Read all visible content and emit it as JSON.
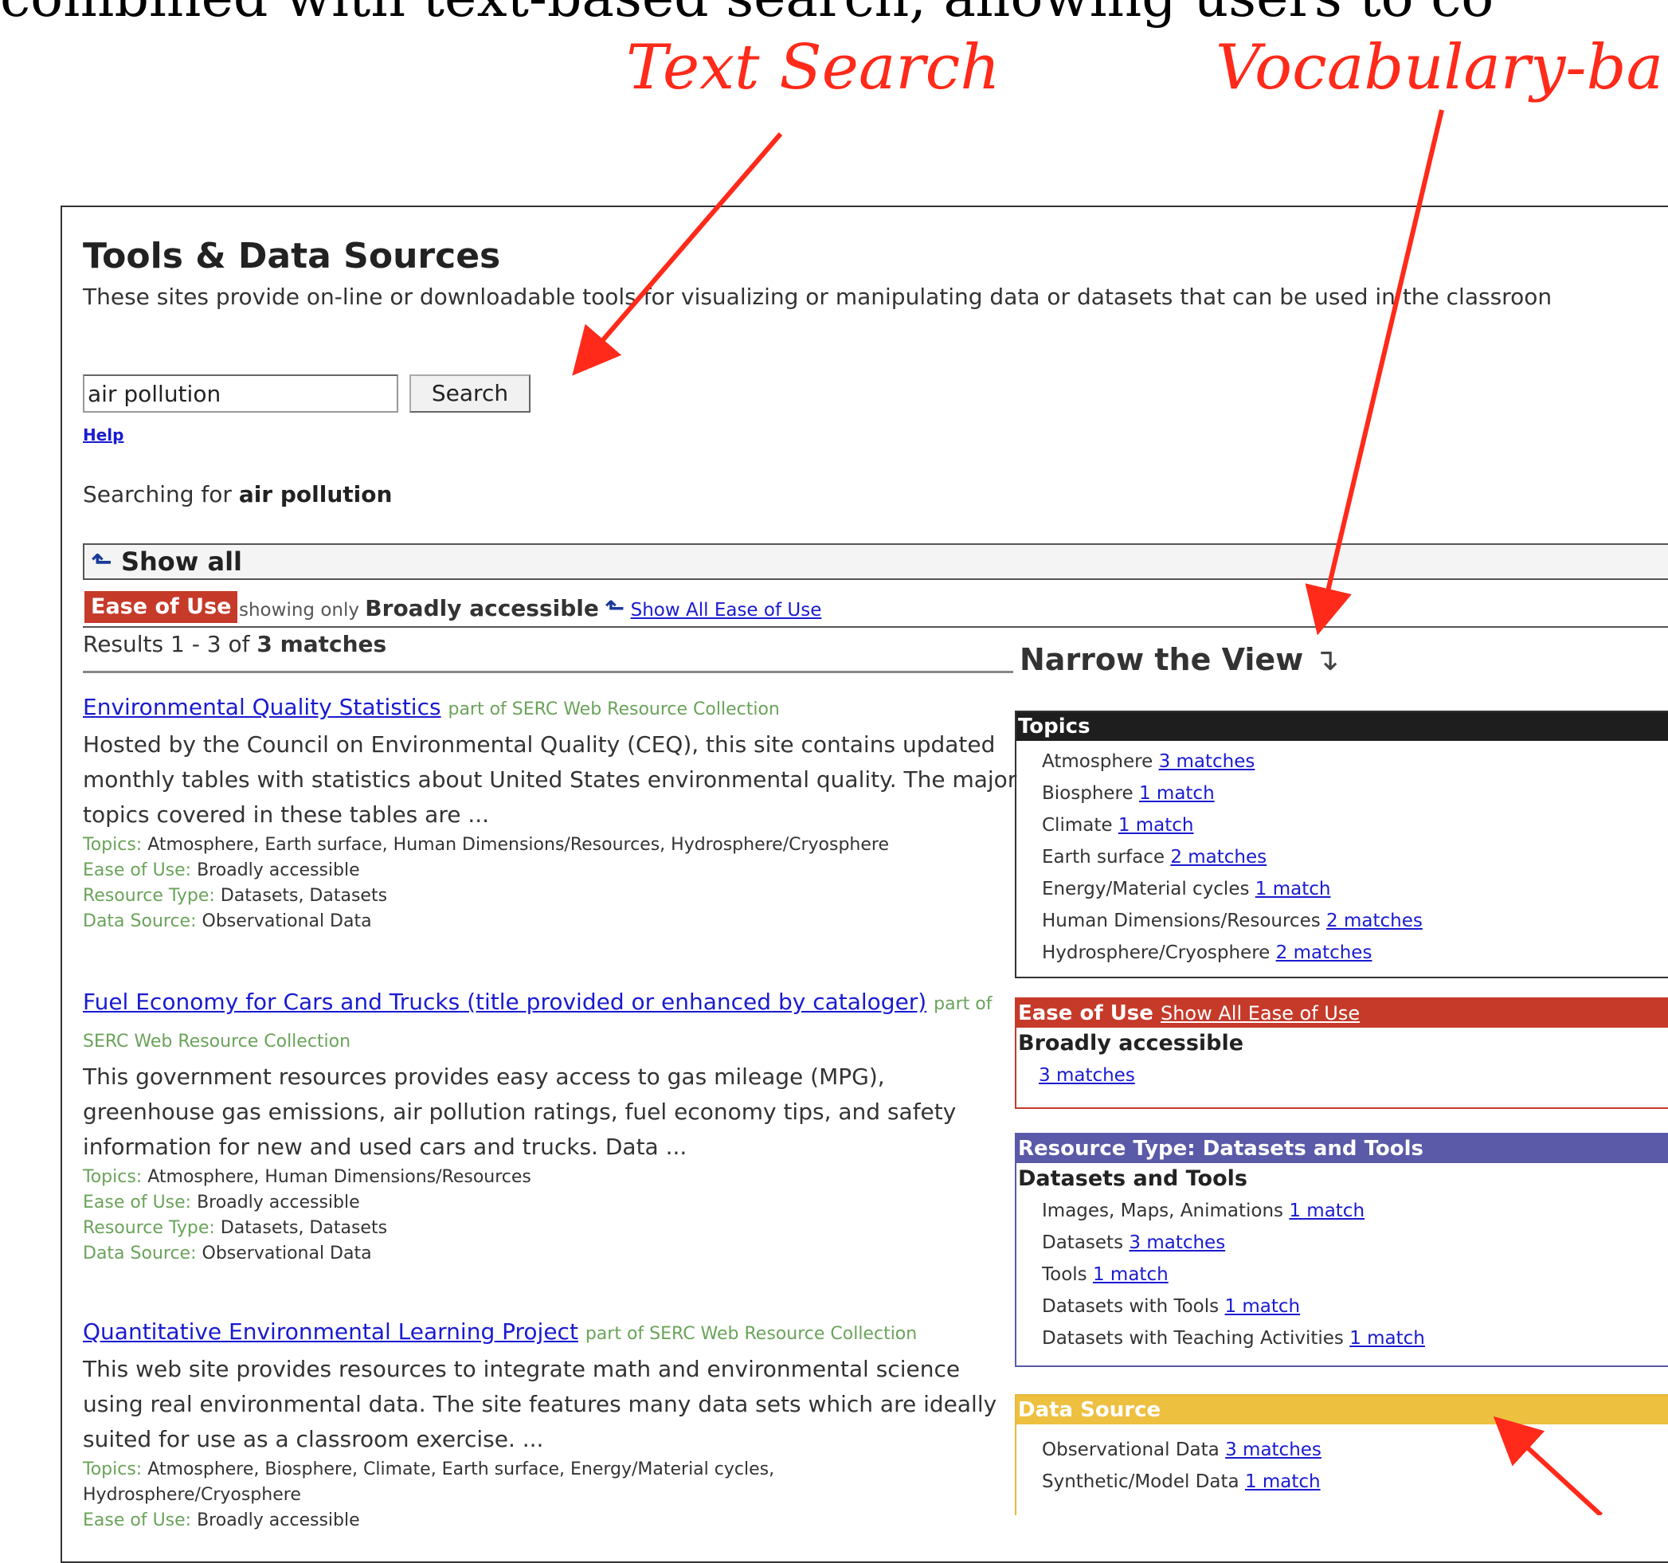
{
  "slide": {
    "top_text": "combined with text-based search, allowing users to co",
    "annotation_text_search": "Text Search",
    "annotation_vocab": "Vocabulary-ba"
  },
  "page": {
    "title": "Tools & Data Sources",
    "intro": "These sites provide on-line or downloadable tools for visualizing or manipulating data or datasets that can be used in the classroon"
  },
  "search": {
    "value": "air pollution",
    "button": "Search",
    "help": "Help",
    "searching_prefix": "Searching for",
    "searching_term": "air pollution"
  },
  "filters": {
    "show_all": "Show all",
    "ease_badge": "Ease of Use",
    "showing_only": "showing only",
    "showing_value": "Broadly accessible",
    "show_all_ease": "Show All Ease of Use"
  },
  "results_summary": {
    "prefix": "Results 1 - 3 of",
    "count": "3 matches"
  },
  "results": [
    {
      "title": "Environmental Quality Statistics",
      "part": "part of SERC Web Resource Collection",
      "desc": "Hosted by the Council on Environmental Quality (CEQ), this site contains updated monthly tables with statistics about United States environmental quality. The major topics covered in these tables are ...",
      "topics_k": "Topics:",
      "topics_v": "Atmosphere, Earth surface, Human Dimensions/Resources, Hydrosphere/Cryosphere",
      "ease_k": "Ease of Use:",
      "ease_v": "Broadly accessible",
      "rtype_k": "Resource Type:",
      "rtype_v": "Datasets, Datasets",
      "source_k": "Data Source:",
      "source_v": "Observational Data"
    },
    {
      "title": "Fuel Economy for Cars and Trucks (title provided or enhanced by cataloger)",
      "part": "part of SERC Web Resource Collection",
      "desc": "This government resources provides easy access to gas mileage (MPG), greenhouse gas emissions, air pollution ratings, fuel economy tips, and safety information for new and used cars and trucks. Data ...",
      "topics_k": "Topics:",
      "topics_v": "Atmosphere, Human Dimensions/Resources",
      "ease_k": "Ease of Use:",
      "ease_v": "Broadly accessible",
      "rtype_k": "Resource Type:",
      "rtype_v": "Datasets, Datasets",
      "source_k": "Data Source:",
      "source_v": "Observational Data"
    },
    {
      "title": "Quantitative Environmental Learning Project",
      "part": "part of SERC Web Resource Collection",
      "desc": "This web site provides resources to integrate math and environmental science using real environmental data. The site features many data sets which are ideally suited for use as a classroom exercise. ...",
      "topics_k": "Topics:",
      "topics_v": "Atmosphere, Biosphere, Climate, Earth surface, Energy/Material cycles,",
      "topics_v2": "Hydrosphere/Cryosphere",
      "ease_k": "Ease of Use:",
      "ease_v": "Broadly accessible"
    }
  ],
  "narrow": {
    "title": "Narrow the View",
    "topics_head": "Topics",
    "topics": [
      {
        "label": "Atmosphere",
        "count": "3 matches"
      },
      {
        "label": "Biosphere",
        "count": "1 match"
      },
      {
        "label": "Climate",
        "count": "1 match"
      },
      {
        "label": "Earth surface",
        "count": "2 matches"
      },
      {
        "label": "Energy/Material cycles",
        "count": "1 match"
      },
      {
        "label": "Human Dimensions/Resources",
        "count": "2 matches"
      },
      {
        "label": "Hydrosphere/Cryosphere",
        "count": "2 matches"
      }
    ],
    "ease_head": "Ease of Use",
    "ease_show_all": "Show All Ease of Use",
    "ease_value": "Broadly accessible",
    "ease_count": "3 matches",
    "resource_head": "Resource Type: Datasets and Tools",
    "resource_sub": "Datasets and Tools",
    "resources": [
      {
        "label": "Images, Maps, Animations",
        "count": "1 match"
      },
      {
        "label": "Datasets",
        "count": "3 matches"
      },
      {
        "label": "Tools",
        "count": "1 match"
      },
      {
        "label": "Datasets with Tools",
        "count": "1 match"
      },
      {
        "label": "Datasets with Teaching Activities",
        "count": "1 match"
      }
    ],
    "source_head": "Data Source",
    "sources": [
      {
        "label": "Observational Data",
        "count": "3 matches"
      },
      {
        "label": "Synthetic/Model Data",
        "count": "1 match"
      }
    ]
  },
  "colors": {
    "annotation": "#ff2a1a",
    "ease": "#c63a2a",
    "resource": "#5a5aa8",
    "source": "#eec040",
    "topics": "#1e1e1e",
    "link": "#1a1ad0",
    "meta_key": "#6aa35a"
  }
}
